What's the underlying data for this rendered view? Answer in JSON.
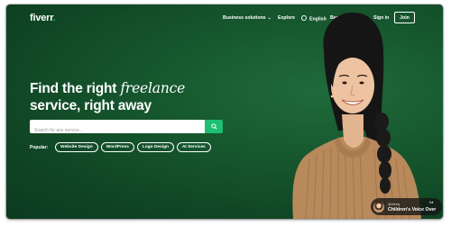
{
  "brand": {
    "logo_text": "fiverr",
    "logo_dot": "."
  },
  "nav": {
    "business": "Business solutions",
    "explore": "Explore",
    "language": "English",
    "become_seller": "Become a Seller",
    "sign_in": "Sign in",
    "join": "Join"
  },
  "hero": {
    "line1_prefix": "Find the right ",
    "line1_emphasis": "freelance",
    "line2": "service, right away"
  },
  "search": {
    "placeholder": "Search for any service..."
  },
  "popular": {
    "label": "Popular:",
    "chips": [
      "Website Design",
      "WordPress",
      "Logo Design",
      "AI Services"
    ]
  },
  "badge": {
    "name": "@Jenny",
    "role": "Children's Voice Over",
    "rating": "5★"
  },
  "colors": {
    "background": "#13502b",
    "accent": "#1dbf73",
    "text": "#ffffff"
  },
  "icons": [
    "chevron-down-icon",
    "globe-icon",
    "search-icon"
  ]
}
